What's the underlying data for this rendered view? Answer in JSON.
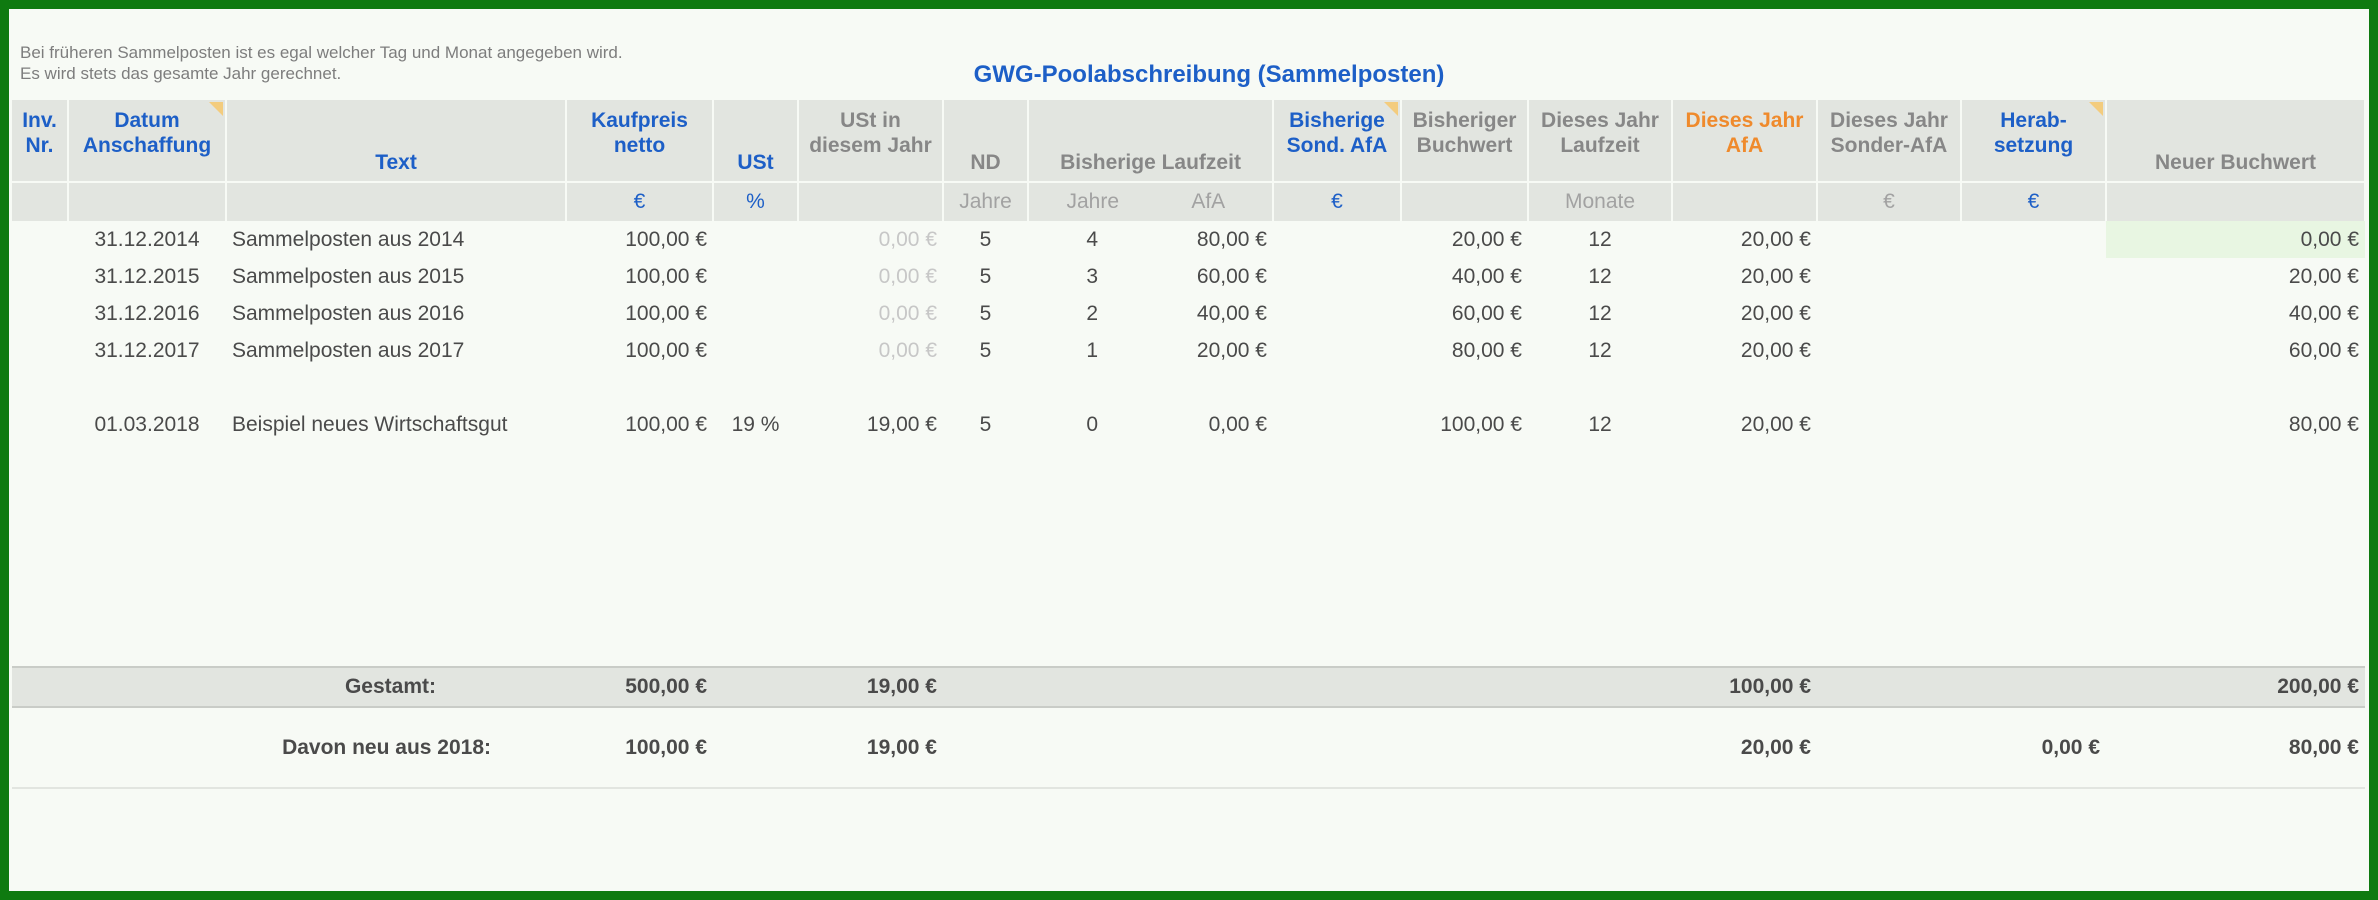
{
  "notes": [
    "Bei früheren Sammelposten ist es egal welcher Tag und Monat angegeben wird.",
    "Es wird stets das gesamte Jahr gerechnet."
  ],
  "title": "GWG-Poolabschreibung (Sammelposten)",
  "columns": {
    "inv": [
      "Inv.",
      "Nr."
    ],
    "datum": [
      "Datum",
      "Anschaffung"
    ],
    "text": "Text",
    "kaufpreis": [
      "Kaufpreis",
      "netto"
    ],
    "ust": "USt",
    "ust_jahr": [
      "USt in",
      "diesem Jahr"
    ],
    "nd": "ND",
    "laufzeit": "Bisherige Laufzeit",
    "sond_afa": [
      "Bisherige",
      "Sond. AfA"
    ],
    "buchwert": [
      "Bisheriger",
      "Buchwert"
    ],
    "jahr_laufzeit": [
      "Dieses Jahr",
      "Laufzeit"
    ],
    "jahr_afa": [
      "Dieses Jahr",
      "AfA"
    ],
    "sonder_afa": [
      "Dieses Jahr",
      "Sonder-AfA"
    ],
    "herab": [
      "Herab-",
      "setzung"
    ],
    "neu_buchwert": "Neuer Buchwert"
  },
  "units": {
    "kaufpreis": "€",
    "ust": "%",
    "nd": "Jahre",
    "laufzeit_jahre": "Jahre",
    "laufzeit_afa": "AfA",
    "sond_afa": "€",
    "jahr_laufzeit": "Monate",
    "sonder_afa": "€",
    "herab": "€"
  },
  "rows": [
    {
      "datum": "31.12.2014",
      "text": "Sammelposten aus 2014",
      "kaufpreis": "100,00 €",
      "ust": "",
      "ust_jahr": "0,00 €",
      "nd": "5",
      "jahre": "4",
      "afa": "80,00 €",
      "buchwert": "20,00 €",
      "laufzeit": "12",
      "jahr_afa": "20,00 €",
      "neu": "0,00 €"
    },
    {
      "datum": "31.12.2015",
      "text": "Sammelposten aus 2015",
      "kaufpreis": "100,00 €",
      "ust": "",
      "ust_jahr": "0,00 €",
      "nd": "5",
      "jahre": "3",
      "afa": "60,00 €",
      "buchwert": "40,00 €",
      "laufzeit": "12",
      "jahr_afa": "20,00 €",
      "neu": "20,00 €"
    },
    {
      "datum": "31.12.2016",
      "text": "Sammelposten aus 2016",
      "kaufpreis": "100,00 €",
      "ust": "",
      "ust_jahr": "0,00 €",
      "nd": "5",
      "jahre": "2",
      "afa": "40,00 €",
      "buchwert": "60,00 €",
      "laufzeit": "12",
      "jahr_afa": "20,00 €",
      "neu": "40,00 €"
    },
    {
      "datum": "31.12.2017",
      "text": "Sammelposten aus 2017",
      "kaufpreis": "100,00 €",
      "ust": "",
      "ust_jahr": "0,00 €",
      "nd": "5",
      "jahre": "1",
      "afa": "20,00 €",
      "buchwert": "80,00 €",
      "laufzeit": "12",
      "jahr_afa": "20,00 €",
      "neu": "60,00 €"
    },
    {
      "datum": "01.03.2018",
      "text": "Beispiel neues Wirtschaftsgut",
      "kaufpreis": "100,00 €",
      "ust": "19 %",
      "ust_jahr": "19,00 €",
      "nd": "5",
      "jahre": "0",
      "afa": "0,00 €",
      "buchwert": "100,00 €",
      "laufzeit": "12",
      "jahr_afa": "20,00 €",
      "neu": "80,00 €"
    }
  ],
  "total": {
    "label": "Gestamt:",
    "kaufpreis": "500,00 €",
    "ust_jahr": "19,00 €",
    "jahr_afa": "100,00 €",
    "neu": "200,00 €"
  },
  "subtotal": {
    "label": "Davon neu aus 2018:",
    "kaufpreis": "100,00 €",
    "ust_jahr": "19,00 €",
    "jahr_afa": "20,00 €",
    "herab": "0,00 €",
    "neu": "80,00 €"
  },
  "colors": {
    "accent_blue": "#1d5fc7",
    "accent_orange": "#ef8a2c",
    "frame_green": "#0f7a10"
  }
}
